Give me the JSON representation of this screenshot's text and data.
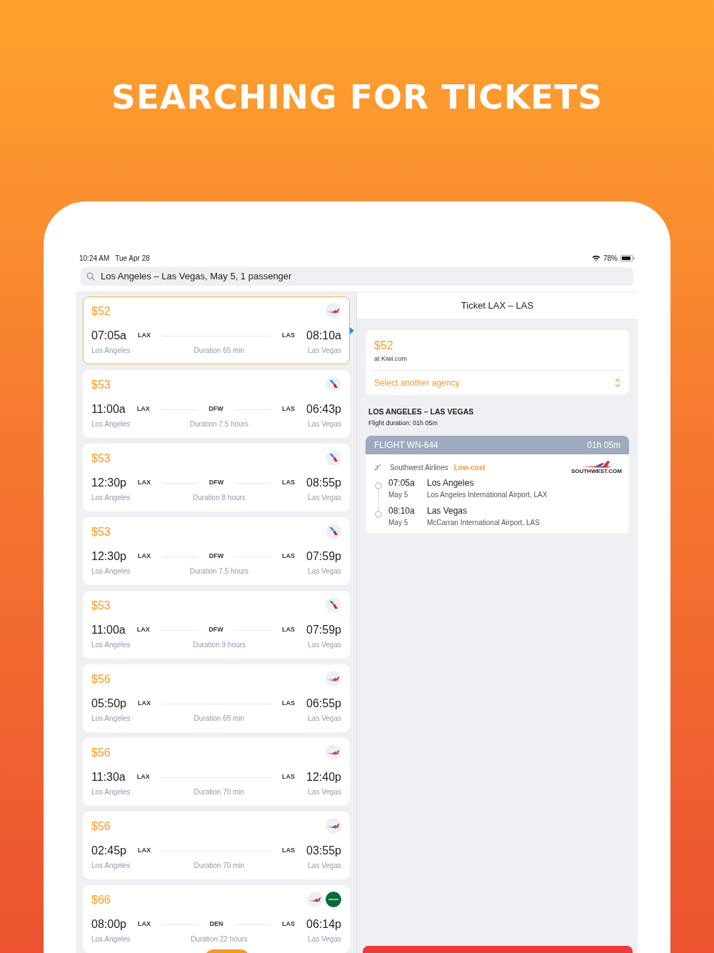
{
  "headline": "SEARCHING FOR TICKETS",
  "status_bar": {
    "time": "10:24 AM",
    "date": "Tue Apr 28",
    "battery": "78%"
  },
  "search": {
    "value": "Los Angeles – Las Vegas, May 5, 1 passenger"
  },
  "results": [
    {
      "price": "$52",
      "selected": true,
      "airlines": [
        {
          "kind": "southwest"
        }
      ],
      "dep_time": "07:05a",
      "from_code": "LAX",
      "to_code": "LAS",
      "arr_time": "08:10a",
      "from_city": "Los Angeles",
      "duration": "Duration 65 min",
      "to_city": "Las Vegas"
    },
    {
      "price": "$53",
      "selected": false,
      "airlines": [
        {
          "kind": "american"
        }
      ],
      "dep_time": "11:00a",
      "from_code": "LAX",
      "via": "DFW",
      "to_code": "LAS",
      "arr_time": "06:43p",
      "from_city": "Los Angeles",
      "duration": "Duration 7.5 hours",
      "to_city": "Las Vegas"
    },
    {
      "price": "$53",
      "selected": false,
      "airlines": [
        {
          "kind": "american"
        }
      ],
      "dep_time": "12:30p",
      "from_code": "LAX",
      "via": "DFW",
      "to_code": "LAS",
      "arr_time": "08:55p",
      "from_city": "Los Angeles",
      "duration": "Duration 8 hours",
      "to_city": "Las Vegas"
    },
    {
      "price": "$53",
      "selected": false,
      "airlines": [
        {
          "kind": "american"
        }
      ],
      "dep_time": "12:30p",
      "from_code": "LAX",
      "via": "DFW",
      "to_code": "LAS",
      "arr_time": "07:59p",
      "from_city": "Los Angeles",
      "duration": "Duration 7.5 hours",
      "to_city": "Las Vegas"
    },
    {
      "price": "$53",
      "selected": false,
      "airlines": [
        {
          "kind": "american"
        }
      ],
      "dep_time": "11:00a",
      "from_code": "LAX",
      "via": "DFW",
      "to_code": "LAS",
      "arr_time": "07:59p",
      "from_city": "Los Angeles",
      "duration": "Duration 9 hours",
      "to_city": "Las Vegas"
    },
    {
      "price": "$56",
      "selected": false,
      "airlines": [
        {
          "kind": "southwest"
        }
      ],
      "dep_time": "05:50p",
      "from_code": "LAX",
      "to_code": "LAS",
      "arr_time": "06:55p",
      "from_city": "Los Angeles",
      "duration": "Duration 65 min",
      "to_city": "Las Vegas"
    },
    {
      "price": "$56",
      "selected": false,
      "airlines": [
        {
          "kind": "southwest"
        }
      ],
      "dep_time": "11:30a",
      "from_code": "LAX",
      "to_code": "LAS",
      "arr_time": "12:40p",
      "from_city": "Los Angeles",
      "duration": "Duration 70 min",
      "to_city": "Las Vegas"
    },
    {
      "price": "$56",
      "selected": false,
      "airlines": [
        {
          "kind": "southwest"
        }
      ],
      "dep_time": "02:45p",
      "from_code": "LAX",
      "to_code": "LAS",
      "arr_time": "03:55p",
      "from_city": "Los Angeles",
      "duration": "Duration 70 min",
      "to_city": "Las Vegas"
    },
    {
      "price": "$66",
      "selected": false,
      "airlines": [
        {
          "kind": "southwest"
        },
        {
          "kind": "frontier"
        }
      ],
      "dep_time": "08:00p",
      "from_code": "LAX",
      "via": "DEN",
      "to_code": "LAS",
      "arr_time": "06:14p",
      "from_city": "Los Angeles",
      "duration": "Duration 22 hours",
      "to_city": "Las Vegas"
    }
  ],
  "detail": {
    "title": "Ticket LAX – LAS",
    "price": "$52",
    "agency": "at Kiwi.com",
    "select_agency": "Select another agency",
    "route": "LOS ANGELES – LAS VEGAS",
    "flight_duration": "Flight duration: 01h 05m",
    "flight": {
      "number": "FLIGHT WN-644",
      "duration": "01h 05m",
      "airline": "Southwest Airlines",
      "tag": "Low-cost",
      "logo_text": "SOUTHWEST.COM",
      "stops": [
        {
          "time": "07:05a",
          "date": "May 5",
          "city": "Los Angeles",
          "airport": "Los Angeles International Airport, LAX"
        },
        {
          "time": "08:10a",
          "date": "May 5",
          "city": "Las Vegas",
          "airport": "McCarran International Airport, LAS"
        }
      ]
    }
  }
}
